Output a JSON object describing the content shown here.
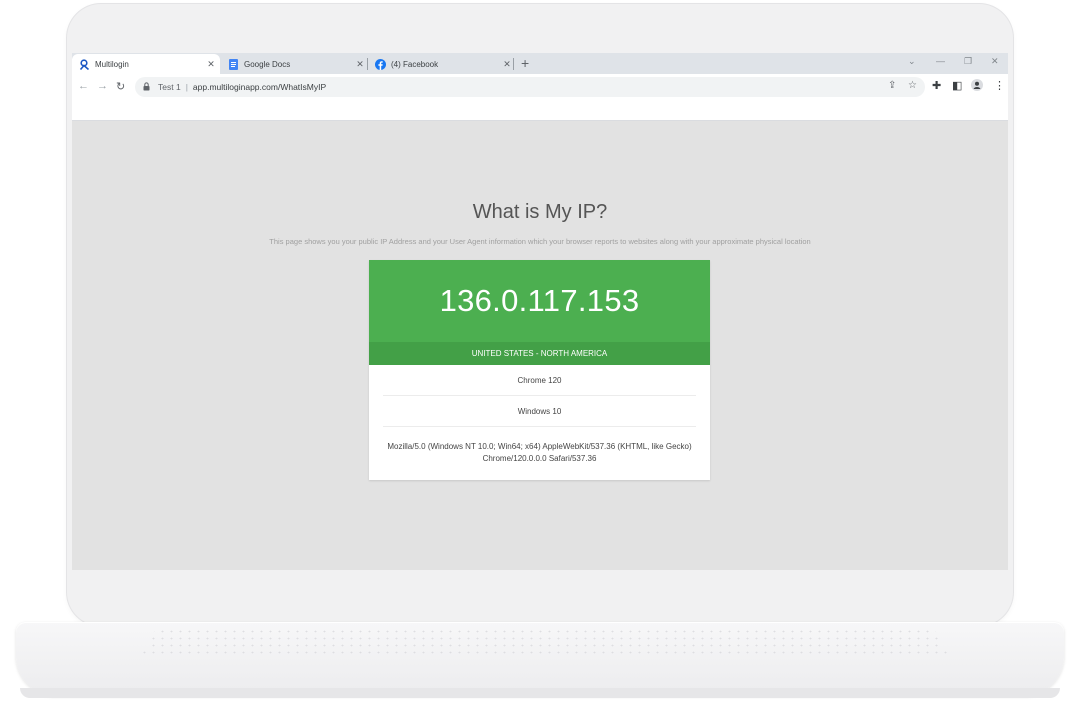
{
  "browser": {
    "tabs": [
      {
        "title": "Multilogin",
        "active": true,
        "icon": "multilogin-icon"
      },
      {
        "title": "Google Docs",
        "active": false,
        "icon": "google-docs-icon"
      },
      {
        "title": "(4) Facebook",
        "active": false,
        "icon": "facebook-icon"
      }
    ],
    "address_bar": {
      "profile_label": "Test 1",
      "url": "app.multiloginapp.com/WhatIsMyIP"
    }
  },
  "page": {
    "title": "What is My IP?",
    "description": "This page shows you your public IP Address and your User Agent information which your browser reports to websites along with your approximate physical location",
    "ip_address": "136.0.117.153",
    "location": "UNITED STATES - NORTH AMERICA",
    "browser_name": "Chrome 120",
    "os": "Windows 10",
    "user_agent_line1": "Mozilla/5.0 (Windows NT 10.0; Win64; x64) AppleWebKit/537.36 (KHTML, like Gecko)",
    "user_agent_line2": "Chrome/120.0.0.0 Safari/537.36"
  },
  "colors": {
    "ip_card_green": "#4caf50",
    "location_bar_green": "#43a047",
    "page_background": "#e2e2e2"
  }
}
